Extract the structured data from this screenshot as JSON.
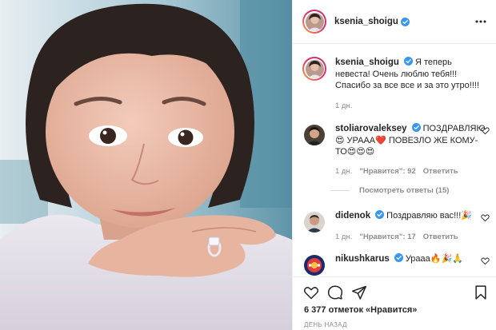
{
  "post": {
    "username": "ksenia_shoigu",
    "caption": "Я теперь невеста! Очень люблю тебя!!! Спасибо за все все и за это утро!!!!",
    "caption_time": "1 дн.",
    "likes": "6 377 отметок «Нравится»",
    "date": "ДЕНЬ НАЗАД"
  },
  "comments": [
    {
      "username": "stoliarovaleksey",
      "text": "ПОЗДРАВЛЯЮ 😍 УРААА❤️ ПОВЕЗЛО ЖЕ КОМУ-ТО😍😍😍",
      "time": "1 дн.",
      "likes": "\"Нравится\": 92",
      "reply": "Ответить",
      "view_replies": "Посмотреть ответы (15)"
    },
    {
      "username": "didenok",
      "text": "Поздравляю вас!!!🎉",
      "time": "1 дн.",
      "likes": "\"Нравится\": 17",
      "reply": "Ответить"
    },
    {
      "username": "nikushkarus",
      "text": "Урааа🔥🎉🙏",
      "time": "",
      "likes": "",
      "reply": ""
    }
  ],
  "icons": {
    "verified": "verified-badge-icon",
    "more": "more-options-icon",
    "like": "heart-icon",
    "comment": "comment-icon",
    "share": "share-icon",
    "save": "bookmark-icon"
  },
  "colors": {
    "verified": "#3897f0",
    "text": "#262626",
    "muted": "#8e8e8e",
    "border": "#efefef"
  }
}
